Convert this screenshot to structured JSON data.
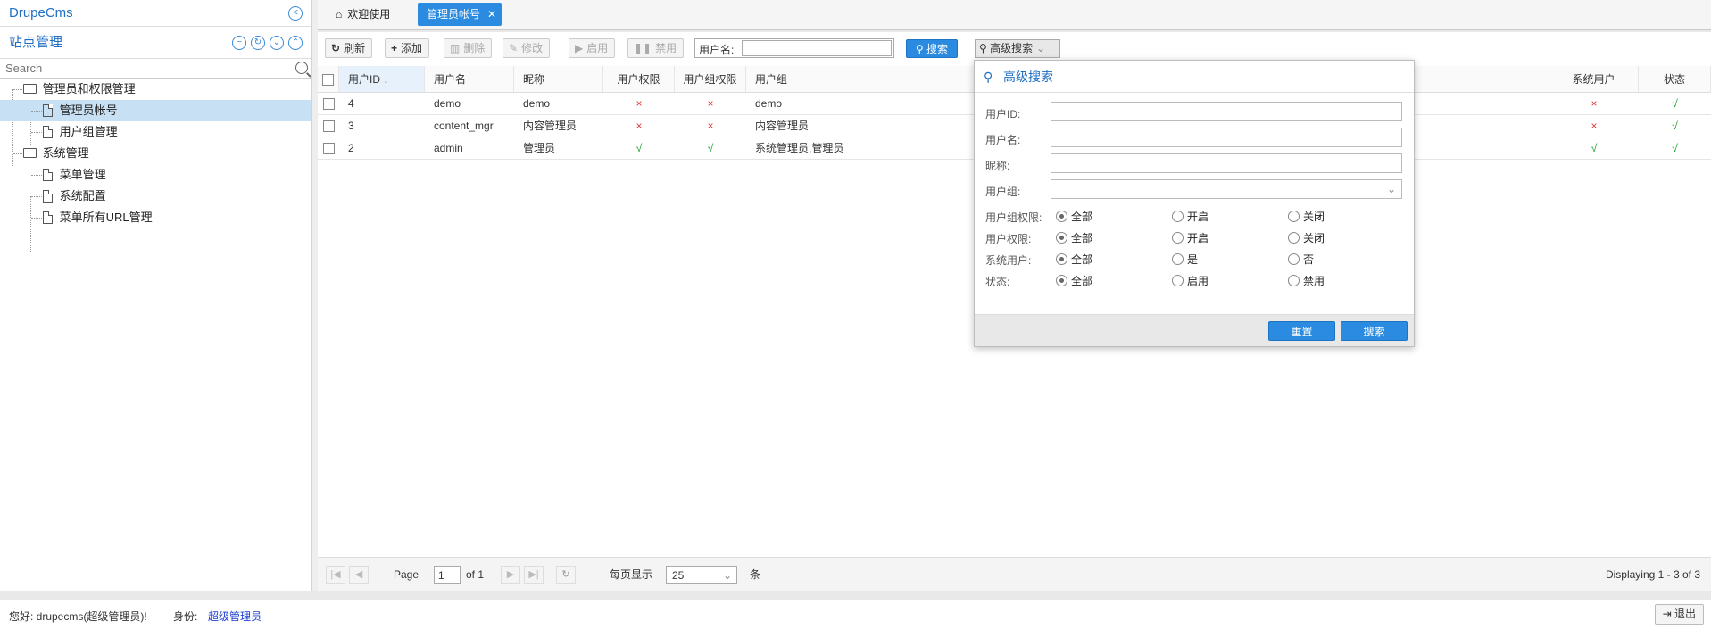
{
  "app": {
    "brand": "DrupeCms"
  },
  "sidebar": {
    "title": "站点管理",
    "search_placeholder": "Search",
    "tree": [
      {
        "label": "管理员和权限管理",
        "level": 0,
        "type": "folder"
      },
      {
        "label": "管理员帐号",
        "level": 1,
        "type": "file",
        "selected": true
      },
      {
        "label": "用户组管理",
        "level": 1,
        "type": "file"
      },
      {
        "label": "系统管理",
        "level": 0,
        "type": "folder"
      },
      {
        "label": "菜单管理",
        "level": 1,
        "type": "file"
      },
      {
        "label": "系统配置",
        "level": 1,
        "type": "file"
      },
      {
        "label": "菜单所有URL管理",
        "level": 1,
        "type": "file"
      }
    ]
  },
  "tabs": [
    {
      "label": "欢迎使用",
      "icon": "home-icon"
    },
    {
      "label": "管理员帐号",
      "active": true
    }
  ],
  "toolbar": {
    "refresh": "刷新",
    "add": "添加",
    "delete": "删除",
    "edit": "修改",
    "enable": "启用",
    "disable": "禁用",
    "username_label": "用户名:",
    "username_value": "",
    "search": "搜索",
    "advanced": "高级搜索"
  },
  "grid": {
    "columns": [
      "用户ID",
      "用户名",
      "昵称",
      "用户权限",
      "用户组权限",
      "用户组",
      "系统用户",
      "状态"
    ],
    "rows": [
      {
        "id": "4",
        "username": "demo",
        "nickname": "demo",
        "user_perm": "×",
        "group_perm": "×",
        "group": "demo",
        "system": "×",
        "status": "√"
      },
      {
        "id": "3",
        "username": "content_mgr",
        "nickname": "内容管理员",
        "user_perm": "×",
        "group_perm": "×",
        "group": "内容管理员",
        "system": "×",
        "status": "√"
      },
      {
        "id": "2",
        "username": "admin",
        "nickname": "管理员",
        "user_perm": "√",
        "group_perm": "√",
        "group": "系统管理员,管理员",
        "system": "√",
        "status": "√"
      }
    ]
  },
  "pager": {
    "page_label": "Page",
    "page_value": "1",
    "of_label": "of 1",
    "per_page_label": "每页显示",
    "per_page_value": "25",
    "unit": "条",
    "display": "Displaying 1 - 3 of 3"
  },
  "status_bar": {
    "greeting": "您好: drupecms(超级管理员)!",
    "role_label": "身份:",
    "role_value": "超级管理员",
    "logout": "退出"
  },
  "advanced_search": {
    "title": "高级搜索",
    "fields": {
      "user_id": "用户ID:",
      "username": "用户名:",
      "nickname": "昵称:",
      "group": "用户组:"
    },
    "radios": [
      {
        "label": "用户组权限:",
        "options": [
          "全部",
          "开启",
          "关闭"
        ],
        "selected": 0
      },
      {
        "label": "用户权限:",
        "options": [
          "全部",
          "开启",
          "关闭"
        ],
        "selected": 0
      },
      {
        "label": "系统用户:",
        "options": [
          "全部",
          "是",
          "否"
        ],
        "selected": 0
      },
      {
        "label": "状态:",
        "options": [
          "全部",
          "启用",
          "禁用"
        ],
        "selected": 0
      }
    ],
    "reset": "重置",
    "search": "搜索"
  },
  "colors": {
    "accent": "#2a8be0",
    "selected_row": "#c7e0f4",
    "x_mark": "#e03b3b",
    "v_mark": "#1c9e2a"
  }
}
